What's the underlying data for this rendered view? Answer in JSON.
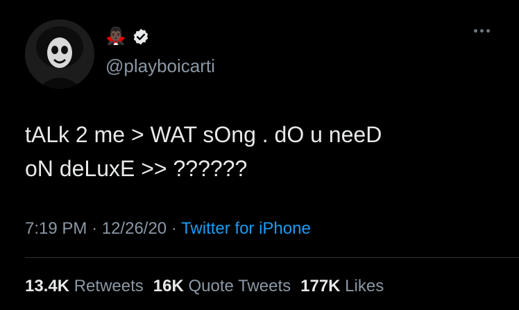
{
  "tweet": {
    "name_emoji": "🧛🏿‍♂️",
    "verified_icon": "verified-badge-icon",
    "handle": "@playboicarti",
    "text": "tALk 2 me > WAT sOng . dO u neeD\noN deLuxE >> ??????",
    "time": "7:19 PM",
    "date": "12/26/20",
    "source": "Twitter for iPhone",
    "separator": "·",
    "stats": {
      "retweets_count": "13.4K",
      "retweets_label": "Retweets",
      "quotes_count": "16K",
      "quotes_label": "Quote Tweets",
      "likes_count": "177K",
      "likes_label": "Likes"
    }
  },
  "colors": {
    "background": "#000000",
    "text_primary": "#e7e9ea",
    "text_secondary": "#8b98a5",
    "link": "#1d9bf0",
    "divider": "#2f3336"
  }
}
